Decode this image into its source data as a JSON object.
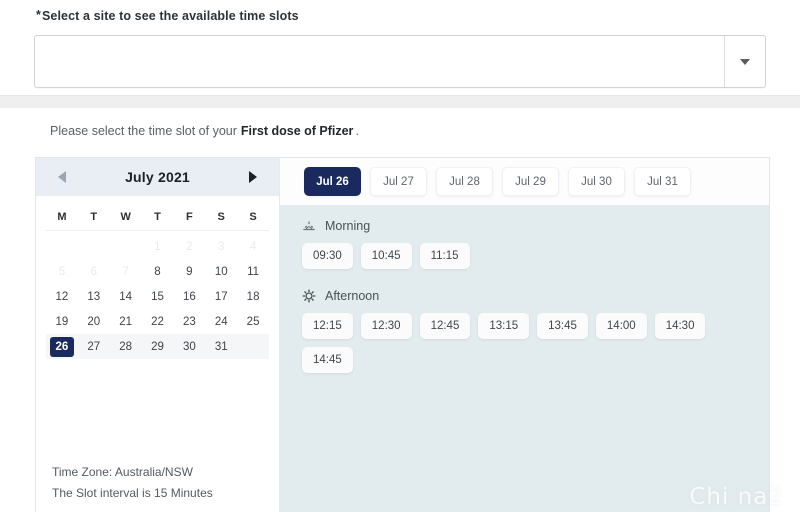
{
  "site_select": {
    "label": "Select a site to see the available time slots",
    "required_marker": "*",
    "value": "",
    "placeholder": "",
    "dropdown_icon": "chevron-down-icon"
  },
  "instruction": {
    "prefix": "Please select the time slot of your",
    "dose": "First dose of Pfizer",
    "suffix": "."
  },
  "calendar": {
    "prev_icon": "chevron-left-icon",
    "next_icon": "chevron-right-icon",
    "month_title": "July 2021",
    "weekdays": [
      "M",
      "T",
      "W",
      "T",
      "F",
      "S",
      "S"
    ],
    "weeks": [
      [
        {
          "day": "",
          "state": "blank"
        },
        {
          "day": "",
          "state": "blank"
        },
        {
          "day": "",
          "state": "blank"
        },
        {
          "day": "1",
          "state": "disabled"
        },
        {
          "day": "2",
          "state": "disabled"
        },
        {
          "day": "3",
          "state": "disabled"
        },
        {
          "day": "4",
          "state": "disabled"
        }
      ],
      [
        {
          "day": "5",
          "state": "disabled"
        },
        {
          "day": "6",
          "state": "disabled"
        },
        {
          "day": "7",
          "state": "disabled"
        },
        {
          "day": "8",
          "state": "normal"
        },
        {
          "day": "9",
          "state": "normal"
        },
        {
          "day": "10",
          "state": "normal"
        },
        {
          "day": "11",
          "state": "normal"
        }
      ],
      [
        {
          "day": "12",
          "state": "normal"
        },
        {
          "day": "13",
          "state": "normal"
        },
        {
          "day": "14",
          "state": "normal"
        },
        {
          "day": "15",
          "state": "normal"
        },
        {
          "day": "16",
          "state": "normal"
        },
        {
          "day": "17",
          "state": "normal"
        },
        {
          "day": "18",
          "state": "normal"
        }
      ],
      [
        {
          "day": "19",
          "state": "normal"
        },
        {
          "day": "20",
          "state": "normal"
        },
        {
          "day": "21",
          "state": "normal"
        },
        {
          "day": "22",
          "state": "normal"
        },
        {
          "day": "23",
          "state": "normal"
        },
        {
          "day": "24",
          "state": "normal"
        },
        {
          "day": "25",
          "state": "normal"
        }
      ],
      [
        {
          "day": "26",
          "state": "selected"
        },
        {
          "day": "27",
          "state": "normal"
        },
        {
          "day": "28",
          "state": "normal"
        },
        {
          "day": "29",
          "state": "normal"
        },
        {
          "day": "30",
          "state": "normal"
        },
        {
          "day": "31",
          "state": "normal"
        },
        {
          "day": "",
          "state": "blank"
        }
      ]
    ],
    "shaded_week_index": 4,
    "footer": {
      "time_zone": "Time Zone: Australia/NSW",
      "slot_interval": "The Slot interval is 15 Minutes"
    }
  },
  "date_tabs": [
    {
      "label": "Jul 26",
      "active": true
    },
    {
      "label": "Jul 27",
      "active": false
    },
    {
      "label": "Jul 28",
      "active": false
    },
    {
      "label": "Jul 29",
      "active": false
    },
    {
      "label": "Jul 30",
      "active": false
    },
    {
      "label": "Jul 31",
      "active": false
    }
  ],
  "slot_sections": [
    {
      "title": "Morning",
      "icon": "sunrise-icon",
      "slots": [
        "09:30",
        "10:45",
        "11:15"
      ]
    },
    {
      "title": "Afternoon",
      "icon": "sun-icon",
      "slots": [
        "12:15",
        "12:30",
        "12:45",
        "13:15",
        "13:45",
        "14:00",
        "14:30",
        "14:45"
      ]
    }
  ],
  "watermark": {
    "text": "Chi na2"
  },
  "colors": {
    "accent_navy": "#1b2a5e",
    "panel_bg": "#e2ebee",
    "calendar_header_bg": "#e8eef3",
    "page_bg": "#ffffff",
    "strip_bg": "#efefef"
  }
}
